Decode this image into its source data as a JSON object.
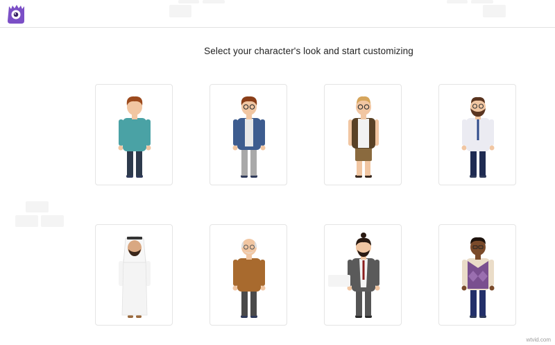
{
  "header": {
    "logo_icon": "purple-monster-logo-icon",
    "brand_color": "#7b4fc6"
  },
  "main": {
    "headline": "Select your character's look and start customizing"
  },
  "characters": [
    {
      "name": "teal-sweater-man"
    },
    {
      "name": "hoodie-glasses-man"
    },
    {
      "name": "vest-glasses-man"
    },
    {
      "name": "tie-bearded-man"
    },
    {
      "name": "arab-robe-man"
    },
    {
      "name": "elderly-bald-man"
    },
    {
      "name": "topknot-suit-man"
    },
    {
      "name": "argyle-vest-man"
    }
  ],
  "footer": {
    "watermark": "wtvid.com"
  }
}
